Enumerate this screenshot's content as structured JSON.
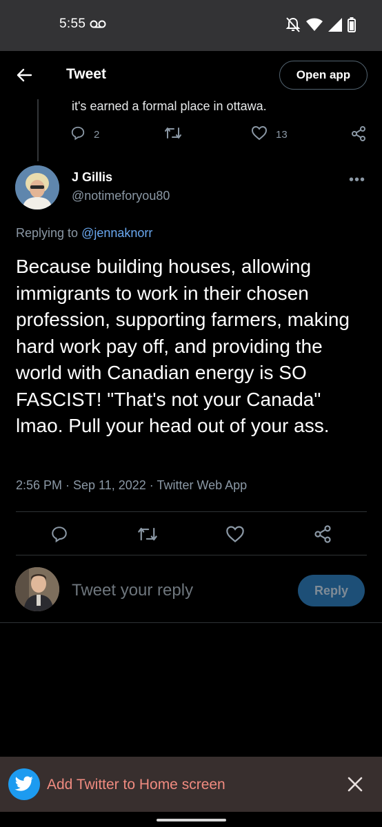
{
  "status_bar": {
    "time": "5:55"
  },
  "header": {
    "title": "Tweet",
    "open_app_label": "Open app"
  },
  "previous_tweet": {
    "text": "it's earned a formal place in ottawa.",
    "reply_count": "2",
    "like_count": "13"
  },
  "tweet": {
    "author_name": "J Gillis",
    "author_handle": "@notimeforyou80",
    "replying_prefix": "Replying to",
    "replying_to": "@jennaknorr",
    "body": "Because building houses, allowing immigrants to work in their chosen profession, supporting farmers, making hard work pay off, and providing the world with Canadian energy is SO FASCIST! \"That's not your Canada\" lmao. Pull your head out of your ass.",
    "meta": "2:56 PM · Sep 11, 2022 · Twitter Web App"
  },
  "reply": {
    "placeholder": "Tweet your reply",
    "button_label": "Reply"
  },
  "banner": {
    "text": "Add Twitter to Home screen"
  },
  "colors": {
    "accent": "#1d9bf0",
    "mention": "#6aa8f0",
    "secondary_text": "#8b98a5",
    "banner_bg": "#382f2e",
    "banner_text": "#f08b80"
  }
}
